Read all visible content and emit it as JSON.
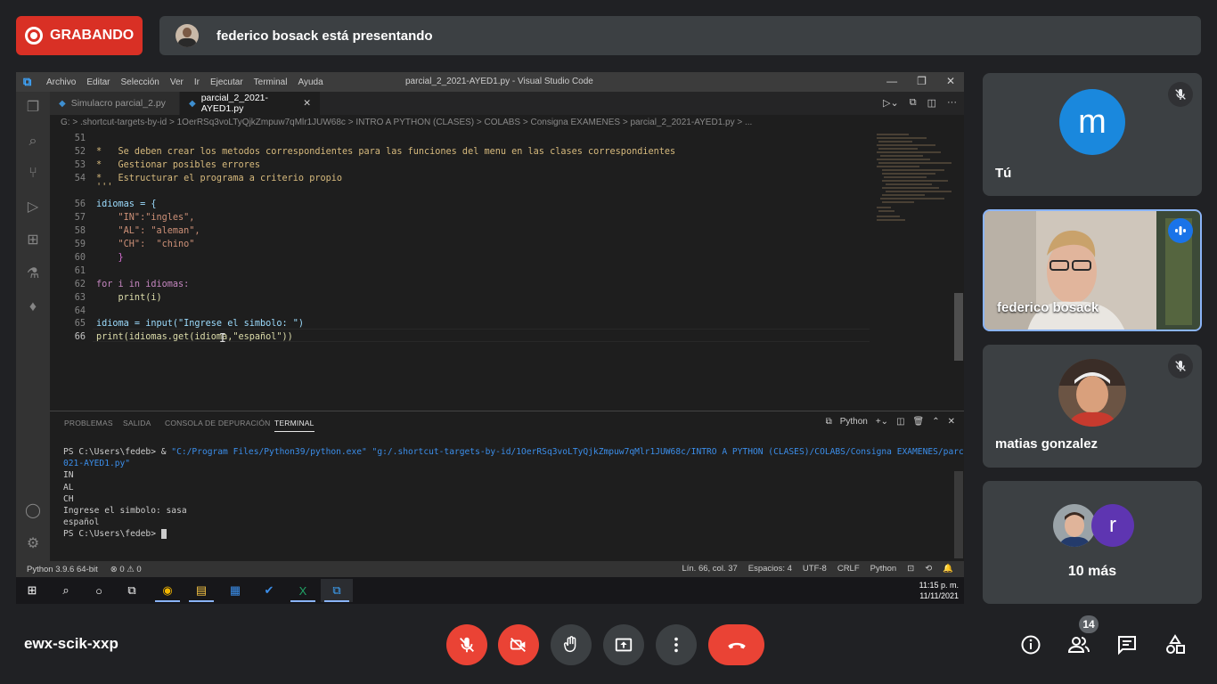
{
  "recording": {
    "label": "GRABANDO"
  },
  "presenter_banner": {
    "text": "federico bosack está presentando"
  },
  "vscode": {
    "menu": [
      "Archivo",
      "Editar",
      "Selección",
      "Ver",
      "Ir",
      "Ejecutar",
      "Terminal",
      "Ayuda"
    ],
    "window_title": "parcial_2_2021-AYED1.py - Visual Studio Code",
    "tabs": [
      {
        "label": "Simulacro parcial_2.py"
      },
      {
        "label": "parcial_2_2021-AYED1.py"
      }
    ],
    "breadcrumb": "G: > .shortcut-targets-by-id > 1OerRSq3voLTyQjkZmpuw7qMlr1JUW68c > INTRO A PYTHON (CLASES) > COLABS > Consigna EXAMENES > parcial_2_2021-AYED1.py > ...",
    "code_lines": [
      {
        "n": "51",
        "text": ""
      },
      {
        "n": "52",
        "text": "*   Se deben crear los metodos correspondientes para las funciones del menu en las clases correspondientes"
      },
      {
        "n": "53",
        "text": "*   Gestionar posibles errores"
      },
      {
        "n": "54",
        "text": "*   Estructurar el programa a criterio propio"
      },
      {
        "n": "",
        "text": "'''"
      },
      {
        "n": "56",
        "text": "idiomas = {"
      },
      {
        "n": "57",
        "text": "    \"IN\":\"ingles\","
      },
      {
        "n": "58",
        "text": "    \"AL\": \"aleman\","
      },
      {
        "n": "59",
        "text": "    \"CH\":  \"chino\""
      },
      {
        "n": "60",
        "text": "    }"
      },
      {
        "n": "61",
        "text": ""
      },
      {
        "n": "62",
        "text": "for i in idiomas:"
      },
      {
        "n": "63",
        "text": "    print(i)"
      },
      {
        "n": "64",
        "text": ""
      },
      {
        "n": "65",
        "text": "idioma = input(\"Ingrese el simbolo: \")"
      },
      {
        "n": "66",
        "text": "print(idiomas.get(idioma,\"español\"))"
      }
    ],
    "panel_tabs": [
      "PROBLEMAS",
      "SALIDA",
      "CONSOLA DE DEPURACIÓN",
      "TERMINAL"
    ],
    "terminal_shell": "Python",
    "terminal": {
      "cmd_prompt": "PS C:\\Users\\fedeb> & ",
      "cmd_path": "\"C:/Program Files/Python39/python.exe\" \"g:/.shortcut-targets-by-id/1OerRSq3voLTyQjkZmpuw7qMlr1JUW68c/INTRO A PYTHON (CLASES)/COLABS/Consigna EXAMENES/parcial_2_2",
      "cmd_path_cont": "021-AYED1.py\"",
      "output": [
        "IN",
        "AL",
        "CH",
        "Ingrese el simbolo: sasa",
        "español"
      ],
      "last_prompt": "PS C:\\Users\\fedeb> "
    },
    "status": {
      "python": "Python 3.9.6 64-bit",
      "problems": "⊗ 0 ⚠ 0",
      "position": "Lín. 66, col. 37",
      "spaces": "Espacios: 4",
      "encoding": "UTF-8",
      "eol": "CRLF",
      "language": "Python"
    },
    "clock": {
      "time": "11:15 p. m.",
      "date": "11/11/2021"
    }
  },
  "participants": [
    {
      "name": "Tú",
      "avatar_letter": "m",
      "avatar_color": "#1a88dd"
    },
    {
      "name": "federico bosack"
    },
    {
      "name": "matias gonzalez"
    },
    {
      "more": "10 más",
      "avatar_letter": "r",
      "avatar_color": "#5e35b1"
    }
  ],
  "meeting": {
    "code": "ewx-scik-xxp",
    "participant_count": "14"
  },
  "colors": {
    "accent_red": "#ea4335",
    "speaking_border": "#8ab4f8"
  }
}
